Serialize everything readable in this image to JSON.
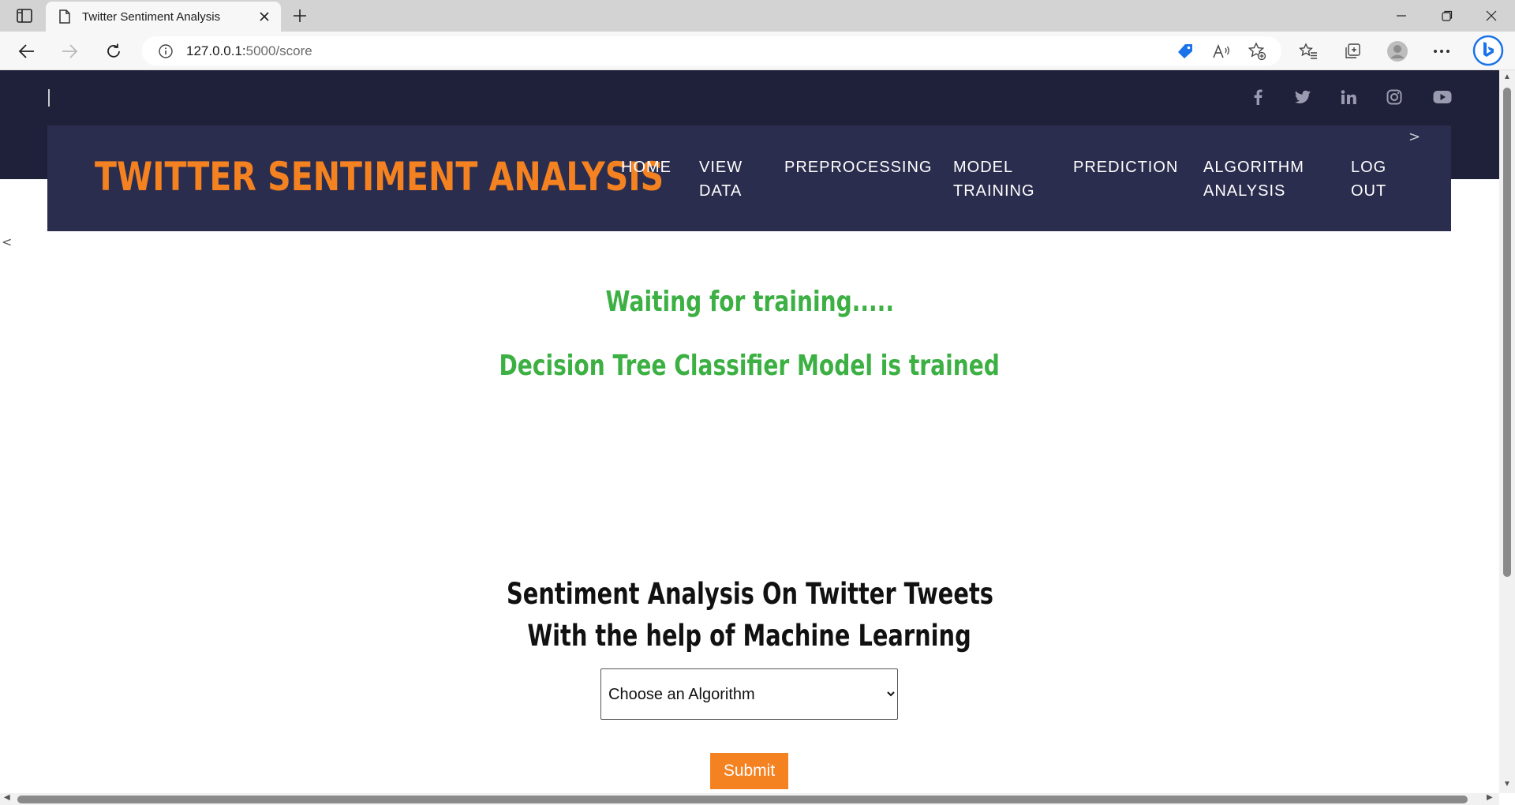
{
  "browser": {
    "tab_title": "Twitter Sentiment Analysis",
    "url_host": "127.0.0.1:",
    "url_path": "5000/score"
  },
  "icons": [
    "tab-actions-icon",
    "document-icon",
    "close-icon",
    "new-tab-icon",
    "minimize-icon",
    "restore-icon",
    "window-close-icon",
    "back-icon",
    "forward-icon",
    "refresh-icon",
    "info-icon",
    "coupon-tag-icon",
    "read-aloud-icon",
    "add-favorite-icon",
    "favorites-icon",
    "collections-icon",
    "profile-icon",
    "more-icon",
    "bing-icon",
    "facebook-icon",
    "twitter-icon",
    "linkedin-icon",
    "instagram-icon",
    "youtube-icon"
  ],
  "site": {
    "brand": "TWITTER SENTIMENT ANALYSIS",
    "nav": [
      {
        "line1": "HOME",
        "line2": ""
      },
      {
        "line1": "VIEW",
        "line2": "DATA"
      },
      {
        "line1": "PREPROCESSING",
        "line2": ""
      },
      {
        "line1": "MODEL",
        "line2": "TRAINING"
      },
      {
        "line1": "PREDICTION",
        "line2": ""
      },
      {
        "line1": "ALGORITHM",
        "line2": "ANALYSIS"
      },
      {
        "line1": "LOG",
        "line2": "OUT"
      }
    ],
    "nav_next": ">",
    "nav_prev": "<"
  },
  "main": {
    "status_waiting": "Waiting for training.....",
    "status_trained": "Decision Tree Classifier Model is trained",
    "heading_line1": "Sentiment Analysis On Twitter Tweets",
    "heading_line2": "With the help of Machine Learning",
    "select_value": "Choose an Algorithm",
    "submit_label": "Submit"
  },
  "colors": {
    "brand_orange": "#f58221",
    "status_green": "#3cb043",
    "topbar": "#1f2039",
    "navbar": "#2b2d4e"
  }
}
